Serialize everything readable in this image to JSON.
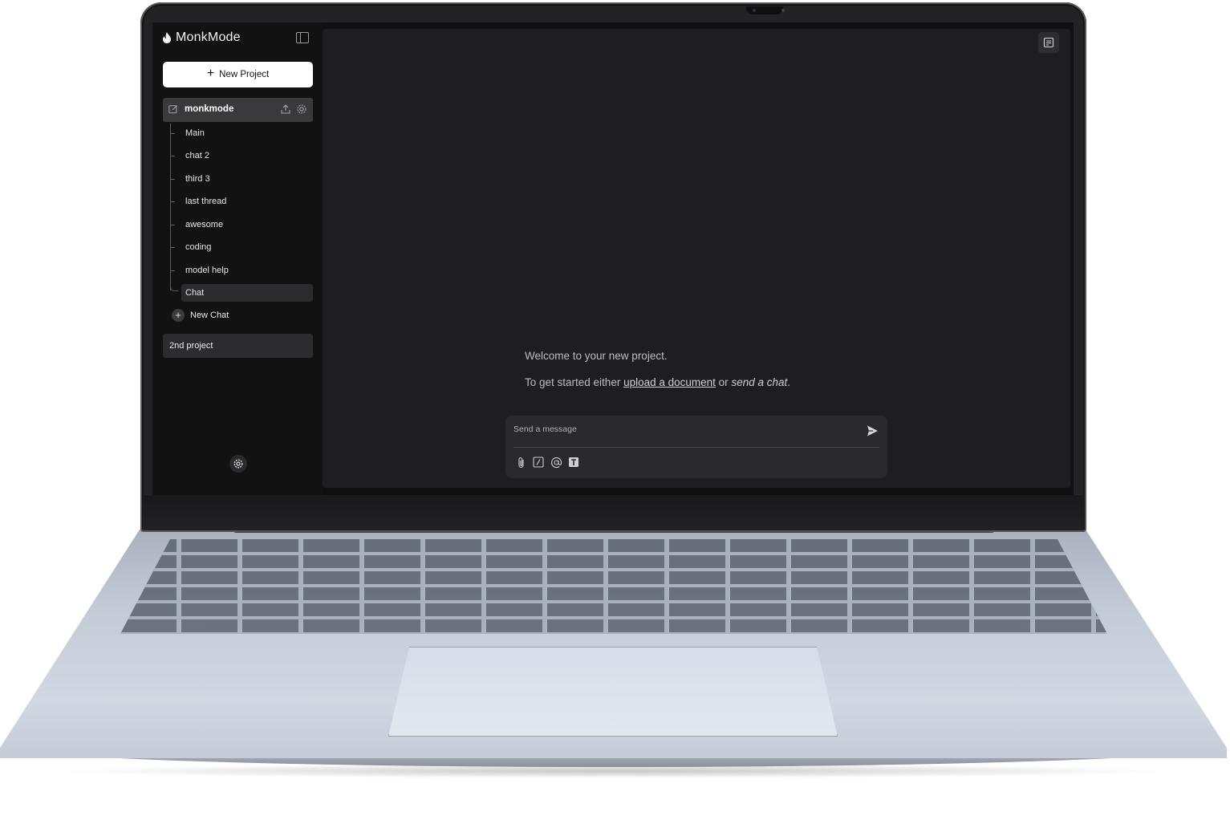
{
  "app": {
    "name": "MonkMode"
  },
  "sidebar": {
    "new_project_label": "New Project",
    "active_project": {
      "name": "monkmode",
      "threads": [
        "Main",
        "chat 2",
        "third 3",
        "last thread",
        "awesome",
        "coding",
        "model help",
        "Chat"
      ],
      "active_thread": "Chat"
    },
    "new_chat_label": "New Chat",
    "other_projects": [
      "2nd project"
    ]
  },
  "main": {
    "welcome": "Welcome to your new project.",
    "get_started_prefix": "To get started either ",
    "upload_link": "upload a document",
    "or_text": " or ",
    "send_chat_link": "send a chat",
    "period": "."
  },
  "composer": {
    "placeholder": "Send a message",
    "tools": [
      "paperclip-icon",
      "slash-command-icon",
      "mention-icon",
      "text-format-icon"
    ]
  },
  "icons": {
    "brand": "flame-icon",
    "collapse": "sidebar-toggle-icon",
    "notes": "notes-icon",
    "settings": "gear-icon",
    "send": "send-icon"
  },
  "colors": {
    "sidebar_bg": "#121213",
    "main_bg": "#1e1e20",
    "accent": "#ffffff"
  }
}
